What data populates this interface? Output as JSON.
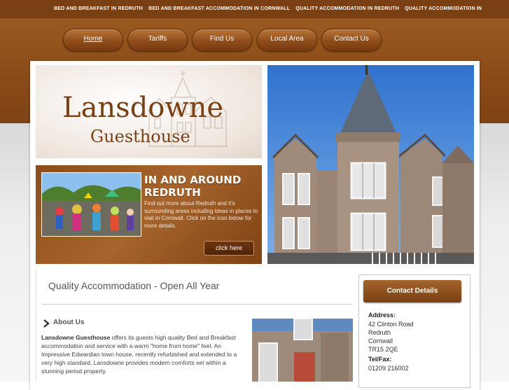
{
  "topstrip": {
    "items": [
      "BED AND BREAKFAST IN REDRUTH",
      "BED AND BREAKFAST ACCOMMODATION IN CORNWALL",
      "QUALITY ACCOMMODATION IN REDRUTH",
      "QUALITY ACCOMMODATION IN"
    ]
  },
  "nav": {
    "items": [
      "Home",
      "Tariffs",
      "Find Us",
      "Local Area",
      "Contact Us"
    ],
    "active": "Home"
  },
  "logo": {
    "title": "Lansdowne",
    "subtitle": "Guesthouse"
  },
  "promo": {
    "title_line1": "IN AND AROUND",
    "title_line2": "REDRUTH",
    "text": "Find out more about Redruth and it's surrounding areas including ideas in places to visit in Cornwall. Click on the icon below for more details.",
    "button": "click here"
  },
  "content": {
    "title": "Quality Accommodation - Open All Year",
    "about_heading": "About Us",
    "about_bold": "Lansdowne Guesthouse",
    "about_text": " offers its guests high quality Bed and Breakfast accommodation and service with a warm \"home from home\" feel. An Impressive Edwardian town house, recently refurbished and extended to a very high standard, Lansdowne provides modern comforts set within a stunning period property."
  },
  "contact": {
    "button": "Contact Details",
    "address_label": "Address:",
    "address_lines": [
      "42 Clinton Road",
      "Redruth",
      "Cornwall",
      "TR15 2QE"
    ],
    "tel_label": "Tel/Fax:",
    "tel": "01209 216002"
  },
  "colors": {
    "brand_brown": "#7a3f12",
    "header_brown": "#8a4a18",
    "text_grey": "#555555"
  }
}
